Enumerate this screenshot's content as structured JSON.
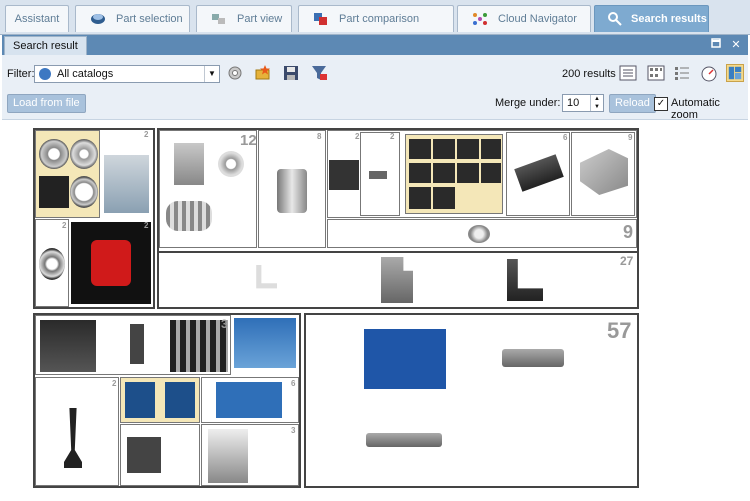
{
  "tabs": [
    {
      "label": "Assistant",
      "icon": "none"
    },
    {
      "label": "Part selection",
      "icon": "part-selection-icon"
    },
    {
      "label": "Part view",
      "icon": "part-view-icon"
    },
    {
      "label": "Part comparison",
      "icon": "part-comparison-icon"
    },
    {
      "label": "Cloud Navigator",
      "icon": "cloud-navigator-icon"
    },
    {
      "label": "Search results",
      "icon": "search-icon"
    }
  ],
  "panel": {
    "title": "Search result"
  },
  "toolbar": {
    "filter_label": "Filter:",
    "filter_value": "All catalogs",
    "result_count": "200 results",
    "load_button": "Load from file",
    "merge_label": "Merge under:",
    "merge_value": "10",
    "reload_button": "Reload",
    "auto_zoom_label": "Automatic zoom",
    "auto_zoom_checked": true
  },
  "clusters": {
    "c1a": "2",
    "c1b": "12",
    "c1c": "8",
    "c1d": "2",
    "c1e": "2",
    "c2a": "2",
    "c2b": "2",
    "c2c": "6",
    "c2d": "9",
    "c2e": "9",
    "c2f": "27",
    "c3a": "3",
    "c3b": "2",
    "c3c": "3",
    "c3d": "6",
    "c3e": "3",
    "c4": "57"
  },
  "colors": {
    "accent": "#7eaad0",
    "panel": "#5d89b4",
    "highlight": "#f4e7b8"
  }
}
